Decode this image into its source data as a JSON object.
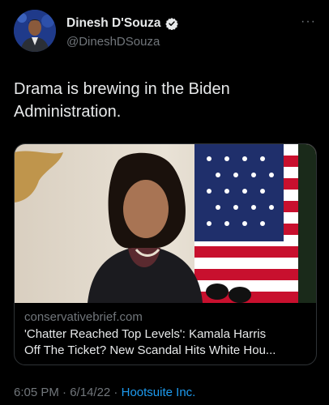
{
  "author": {
    "display_name": "Dinesh D'Souza",
    "handle": "@DineshDSouza"
  },
  "tweet": {
    "text": "Drama is brewing in the Biden Administration."
  },
  "card": {
    "domain": "conservativebrief.com",
    "title_line1": "'Chatter Reached Top Levels': Kamala Harris",
    "title_line2": "Off The Ticket? New Scandal Hits White Hou..."
  },
  "meta": {
    "time": "6:05 PM",
    "separator1": " · ",
    "date": "6/14/22",
    "separator2": " · ",
    "source": "Hootsuite Inc."
  },
  "colors": {
    "background": "#000000",
    "text_primary": "#e7e9ea",
    "text_secondary": "#71767b",
    "link": "#1d9bf0",
    "verified": "#e7e9ea"
  }
}
